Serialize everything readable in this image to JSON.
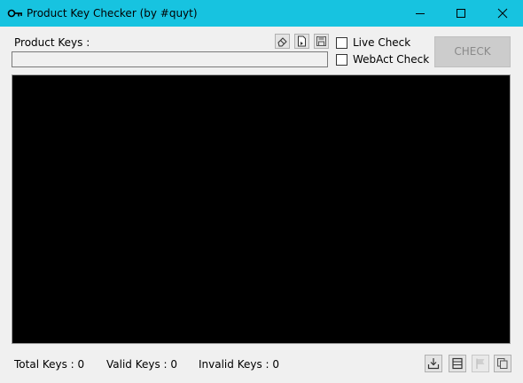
{
  "window": {
    "title": "Product Key Checker (by #quyt)",
    "accent_color": "#17c3e0",
    "icon": "key-icon",
    "controls": [
      "minimize-icon",
      "maximize-icon",
      "close-icon"
    ]
  },
  "input_section": {
    "label": "Product Keys :",
    "value": "",
    "tools": [
      "eraser-icon",
      "open-file-icon",
      "save-icon"
    ]
  },
  "options": {
    "live_check": {
      "label": "Live Check",
      "checked": false
    },
    "webact_check": {
      "label": "WebAct Check",
      "checked": false
    }
  },
  "check_button": {
    "label": "CHECK",
    "enabled": false
  },
  "output": {
    "background": "#000000",
    "text": ""
  },
  "status": {
    "total": "Total Keys : 0",
    "valid": "Valid Keys : 0",
    "invalid": "Invalid Keys : 0"
  },
  "bottom_tools": [
    {
      "icon": "download-icon",
      "enabled": true
    },
    {
      "icon": "list-icon",
      "enabled": true
    },
    {
      "icon": "flag-icon",
      "enabled": false
    },
    {
      "icon": "copy-icon",
      "enabled": true
    }
  ]
}
